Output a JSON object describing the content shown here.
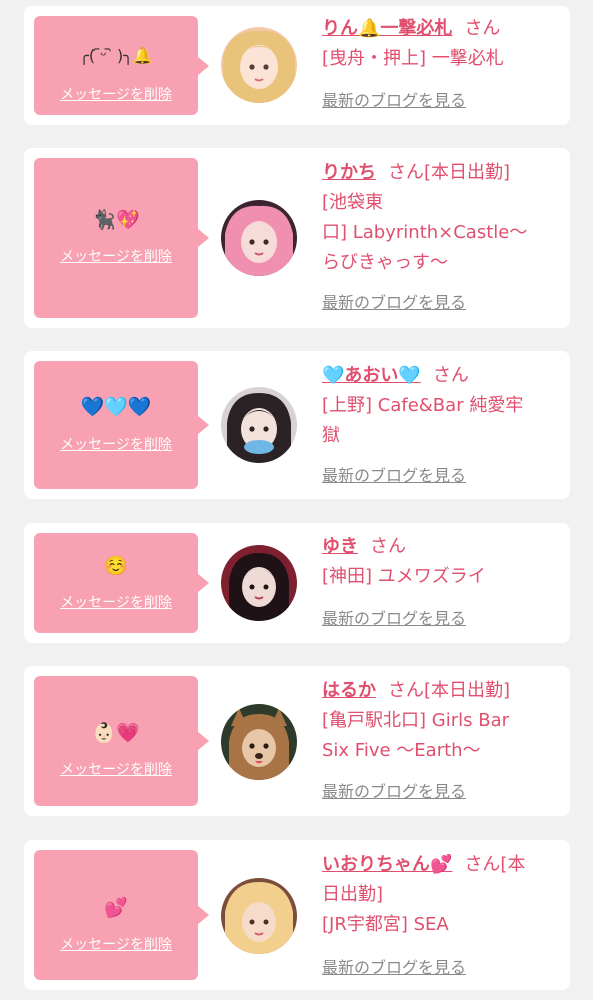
{
  "items": [
    {
      "emoji": "╭(  ᷇ᵕ ᷆  )╮🔔",
      "delete_label": "メッセージを削除",
      "name": "りん🔔一撃必札",
      "honorific": "さん",
      "shop_line1": "[曳舟・押上] 一撃必札",
      "shop_line2": "",
      "shop_line3": "",
      "blog_label": "最新のブログを見る",
      "avatar_bg": "#f3c9a8",
      "avatar_hair": "#e9c37a"
    },
    {
      "emoji": "🐈‍⬛💖",
      "delete_label": "メッセージを削除",
      "name": "りかち",
      "honorific": "さん[本日出勤]",
      "shop_line1": "[池袋東",
      "shop_line2": "口] Labyrinth×Castle〜",
      "shop_line3": "らびきゃっす〜",
      "blog_label": "最新のブログを見る",
      "avatar_bg": "#3b2431",
      "avatar_hair": "#f08fb0"
    },
    {
      "emoji": "💙🩵💙",
      "delete_label": "メッセージを削除",
      "name": "🩵あおい🩵",
      "honorific": "さん",
      "shop_line1": "[上野] Cafe&Bar 純愛牢",
      "shop_line2": "獄",
      "shop_line3": "",
      "blog_label": "最新のブログを見る",
      "avatar_bg": "#d8d2d6",
      "avatar_hair": "#2b2226"
    },
    {
      "emoji": "☺️",
      "delete_label": "メッセージを削除",
      "name": "ゆき",
      "honorific": "さん",
      "shop_line1": "[神田] ユメワズライ",
      "shop_line2": "",
      "shop_line3": "",
      "blog_label": "最新のブログを見る",
      "avatar_bg": "#7e2030",
      "avatar_hair": "#1e1216"
    },
    {
      "emoji": "👶🏻💗",
      "delete_label": "メッセージを削除",
      "name": "はるか",
      "honorific": "さん[本日出勤]",
      "shop_line1": "[亀戸駅北口] Girls Bar",
      "shop_line2": "Six Five 〜Earth〜",
      "shop_line3": "",
      "blog_label": "最新のブログを見る",
      "avatar_bg": "#2e3a2a",
      "avatar_hair": "#a87446"
    },
    {
      "emoji": "💕",
      "delete_label": "メッセージを削除",
      "name": "いおりちゃん💕",
      "honorific": "さん[本",
      "shop_line1": "日出勤]",
      "shop_line2": "[JR宇都宮] SEA",
      "shop_line3": "",
      "blog_label": "最新のブログを見る",
      "avatar_bg": "#7a4e3a",
      "avatar_hair": "#f2cf8c"
    }
  ]
}
